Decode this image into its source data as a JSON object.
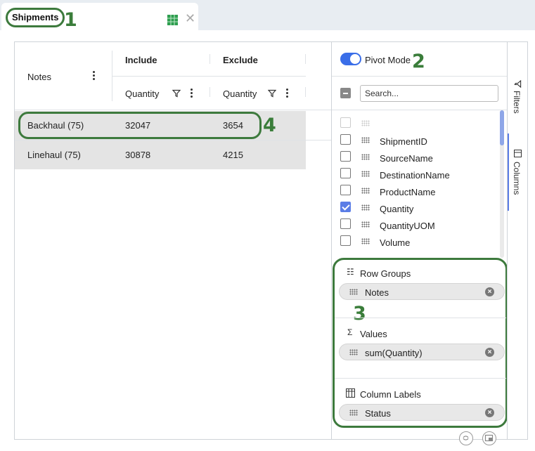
{
  "tab": {
    "title": "Shipments",
    "close": "✕",
    "annotation": "1"
  },
  "grid": {
    "row_group_header": "Notes",
    "pivot_groups": [
      {
        "label": "Include",
        "column": "Quantity"
      },
      {
        "label": "Exclude",
        "column": "Quantity"
      }
    ],
    "rows": [
      {
        "group": "Backhaul (75)",
        "include": "32047",
        "exclude": "3654"
      },
      {
        "group": "Linehaul (75)",
        "include": "30878",
        "exclude": "4215"
      }
    ],
    "row_annotation": "4"
  },
  "side_panel": {
    "pivot_mode_label": "Pivot Mode",
    "pivot_mode_on": true,
    "pivot_annotation": "2",
    "search_placeholder": "Search...",
    "columns": [
      {
        "label": "ShipmentID",
        "checked": false
      },
      {
        "label": "SourceName",
        "checked": false
      },
      {
        "label": "DestinationName",
        "checked": false
      },
      {
        "label": "ProductName",
        "checked": false
      },
      {
        "label": "Quantity",
        "checked": true
      },
      {
        "label": "QuantityUOM",
        "checked": false
      },
      {
        "label": "Volume",
        "checked": false
      }
    ],
    "drop_zones": {
      "annotation": "3",
      "row_groups": {
        "title": "Row Groups",
        "items": [
          "Notes"
        ]
      },
      "values": {
        "title": "Values",
        "items": [
          "sum(Quantity)"
        ]
      },
      "column_labels": {
        "title": "Column Labels",
        "items": [
          "Status"
        ]
      }
    }
  },
  "tool_tabs": [
    "Filters",
    "Columns"
  ],
  "colors": {
    "accent": "#3a6ee8",
    "annotation_green": "#3d7a3d",
    "grid_icon": "#2e9e4f"
  }
}
